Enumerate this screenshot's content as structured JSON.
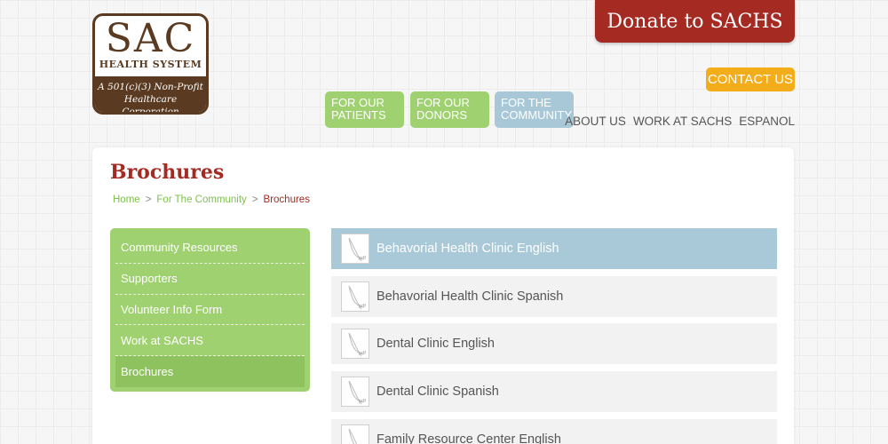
{
  "logo": {
    "name": "SAC",
    "subtitle": "HEALTH SYSTEM",
    "tagline_line1": "A 501(c)(3) Non-Profit",
    "tagline_line2": "Healthcare Corporation"
  },
  "header": {
    "donate_label": "Donate to SACHS",
    "contact_label": "CONTACT US",
    "nav": [
      {
        "label": "FOR OUR PATIENTS"
      },
      {
        "label": "FOR OUR DONORS"
      },
      {
        "label": "FOR THE COMMUNITY"
      }
    ],
    "links": [
      "ABOUT US",
      "WORK AT SACHS",
      "ESPANOL"
    ]
  },
  "page": {
    "title": "Brochures",
    "breadcrumb": [
      "Home",
      "For The Community",
      "Brochures"
    ],
    "breadcrumb_sep": ">"
  },
  "sidebar": {
    "items": [
      {
        "label": "Community Resources"
      },
      {
        "label": "Supporters"
      },
      {
        "label": "Volunteer Info Form"
      },
      {
        "label": "Work at SACHS"
      },
      {
        "label": "Brochures"
      }
    ]
  },
  "brochures": {
    "icon_tag": "pdf",
    "items": [
      {
        "label": "Behavorial Health Clinic English"
      },
      {
        "label": "Behavorial Health Clinic Spanish"
      },
      {
        "label": "Dental Clinic English"
      },
      {
        "label": "Dental Clinic Spanish"
      },
      {
        "label": "Family Resource Center English"
      }
    ]
  },
  "colors": {
    "brand_red": "#a52a22",
    "brand_brown": "#5a3a20",
    "green": "#9fd170",
    "blue": "#a8c8d8",
    "orange": "#f3ad1a"
  }
}
